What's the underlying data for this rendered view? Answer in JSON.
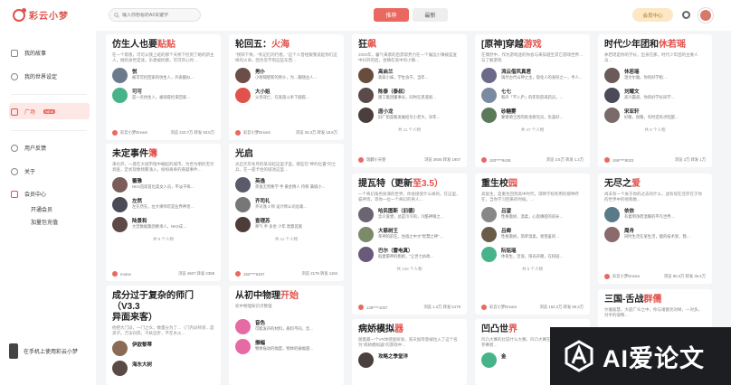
{
  "app": {
    "name": "彩云小梦"
  },
  "search": {
    "placeholder": "输入你想看的AI/关键字"
  },
  "tabs": [
    {
      "label": "推荐",
      "active": true
    },
    {
      "label": "最新",
      "active": false
    }
  ],
  "header": {
    "member_label": "会员中心"
  },
  "sidebar": {
    "items": [
      {
        "label": "我的故事",
        "icon": "book-icon"
      },
      {
        "label": "我的世界设定",
        "icon": "globe-icon"
      },
      {
        "label": "广场",
        "icon": "plaza-icon",
        "badge": "NEW",
        "active": true
      },
      {
        "label": "用户反馈",
        "icon": "feedback-icon"
      },
      {
        "label": "关于",
        "icon": "info-icon"
      },
      {
        "label": "会员中心",
        "icon": "crown-icon"
      }
    ],
    "sub_items": [
      "开通会员",
      "加量包充值"
    ],
    "app_banner": "在手机上使用彩云小梦"
  },
  "cards": [
    {
      "title": "仿生人也要",
      "title_accent": "贴贴",
      "desc": "在一个雨夜，可可从我上班的那个天桥下捡到了她的新主人，她的身世是谜，乐意被抚摸，可可开心时…",
      "chars": [
        {
          "name": "悦",
          "text": "被可可捡回家的仿生人，外表酷似…",
          "color": "#6b7b8c"
        },
        {
          "name": "可可",
          "text": "是一名仿生人，被雨夜捡来回家…",
          "color": "#47b38a"
        }
      ],
      "author": "彩云小梦Dream",
      "stats": "浏览 210.7万  转发 93.8万"
    },
    {
      "title": "未定事件",
      "title_accent": "簿",
      "desc": "来也开，一座在大城市暗中崛起的城市，为世为明的无尽调查，定式现象频繁涌入，纷纷离奇的悬疑事件…",
      "chars": [
        {
          "name": "蕾雅",
          "text": "NKX首席首位美女人员，平淡干练…",
          "color": "#7a5c5a"
        },
        {
          "name": "左然",
          "text": "左先然先，左大律师可是业界神话…",
          "color": "#4b4b58"
        },
        {
          "name": "陆景和",
          "text": "大型数据集团继承人，NKX成…",
          "color": "#5d4a46"
        }
      ],
      "more": "共 9 个人物",
      "author": "mome",
      "stats": "浏览 4607  转发 2358"
    },
    {
      "title": "成分过于复杂的师门（V3.3",
      "title_accent": "",
      "title_line2": "异面来客）",
      "desc": "他把大门派，一门之众，数量分为了…（门内派师弟…是弟子。万法归宗，千妖迈步，不在水火…",
      "chars": [
        {
          "name": "伊欧黎蒂",
          "text": "",
          "color": "#8b6b55"
        },
        {
          "name": "海东大树",
          "text": "",
          "color": "#5a4a45"
        }
      ],
      "author": "",
      "stats": ""
    },
    {
      "title": "轮回五：",
      "title_accent": "火海",
      "desc": "\"残阳下骨，\"有记忆的行者。\"这个人曾经跟我说起你们这样的火命，因为见不到这些东西…",
      "chars": [
        {
          "name": "男仆",
          "text": "小巷隔壁新的男仆，为…跟随主人…",
          "color": "#6b4e4a"
        },
        {
          "name": "大小姐",
          "text": "父母双亡，在家族斗争下面临…",
          "color": "#e1524c"
        }
      ],
      "author": "彩云小梦Dream",
      "stats": "浏览 26.3万  转发 18.8万"
    },
    {
      "title": "光启",
      "title_accent": "",
      "desc": "光启元年冬月的某日起这里子里，那些在\"神的位置\"的士兵，在一座卡住的城池这里…",
      "chars": [
        {
          "name": "英逸",
          "text": "英逸无畏要学 手 黄金情人 持称 满城小…",
          "color": "#5a5a6a"
        },
        {
          "name": "齐司礼",
          "text": "齐司逸 3 师 设计师公司总裁…",
          "color": "#777"
        },
        {
          "name": "查理苏",
          "text": "师气 手 多金 少年 周蓋首富",
          "color": "#4e3c38"
        }
      ],
      "more": "共 11 个人物",
      "author": "183****6207",
      "stats": "浏览 2179  转发 1194"
    },
    {
      "title": "从初中物理",
      "title_accent": "开始",
      "desc": "初中物理知识点整理",
      "chars": [
        {
          "name": "音色",
          "text": "可能发声的材料，质料不同，音…",
          "color": "#e66aa3"
        },
        {
          "name": "振幅",
          "text": "物体振动的幅度，物体的振幅越…",
          "color": "#e66aa3"
        }
      ],
      "author": "",
      "stats": ""
    },
    {
      "title": "狂",
      "title_accent": "飙",
      "desc": "2000年，暮气来袭的后黑帮势力在一个偏远小镇被蓝查中扫开的后，坐镇在高中的小镇…",
      "chars": [
        {
          "name": "高启兰",
          "text": "高家小妹，学生会干，当年…",
          "color": "#6a4c3e"
        },
        {
          "name": "陈泰（泰叔）",
          "text": "建工集团董事长，同时在黑道很…",
          "color": "#5a4a4a"
        },
        {
          "name": "唐小龙",
          "text": "旧厂街菜贩发展结号小老大，早年…",
          "color": "#4a3f3c"
        }
      ],
      "more": "共 11 个人物",
      "author": "瑞麟小天使",
      "stats": "浏览 3605  转发 1907"
    },
    {
      "title": "提瓦特（更新",
      "title_accent": "至3.5）",
      "desc": "一个奇幻角色扮演的世界，你会接受什么样的，在这里，猫神等，等你一位一个奇幻的男人…",
      "chars": [
        {
          "name": "哈民图斯（旧德）",
          "text": "念义爱想，总是冷冷的，冷酷神眼之…",
          "color": "#6c6472"
        },
        {
          "name": "大慈树王",
          "text": "草神的前任，住宿之中大\"智慧之神\"…",
          "color": "#7b8b6a"
        },
        {
          "name": "巴尔（雷电真）",
          "text": "稻妻雷神的胞姐，\"尘世七执政…",
          "color": "#6a5a7a"
        }
      ],
      "more": "共 126 个人物",
      "author": "138****1027",
      "stats": "浏览 1.2万  转发 5179"
    },
    {
      "title": "病娇模拟",
      "title_accent": "器",
      "desc": "随着最一个VR体感屋研发，某天加菲意被拉入了这个名为\"病娇模拟器\"的游戏中…",
      "chars": [
        {
          "name": "攻略之季堂洋",
          "text": "",
          "color": "#4a4040"
        }
      ],
      "author": "",
      "stats": ""
    },
    {
      "title": "[原神]穿越",
      "title_accent": "游戏",
      "desc": "在偶然中，作为游戏迷的你会与来穿越至其它游戏世界…与了解游戏",
      "chars": [
        {
          "name": "流云借风真君",
          "text": "璃月古代山神之主，现化人的身形之一，半人…",
          "color": "#6b6a8a"
        },
        {
          "name": "七七",
          "text": "和声「不卜庐」的年轻药采药员，…",
          "color": "#7a8aa0"
        },
        {
          "name": "砂糖雾",
          "text": "蒙德骑士团的炼金研究员，优美好…",
          "color": "#5a7a5a"
        }
      ],
      "more": "共 47 个人物",
      "author": "183****9428",
      "stats": "浏览 3.5万  转发 1.3万"
    },
    {
      "title": "重生校",
      "title_accent": "园",
      "desc": "高复生，是重生回到高中时代，得畸学校利用的那种存在，当你学习回来的时候，…",
      "chars": [
        {
          "name": "吕望",
          "text": "性格傲娇，温柔，心思缜密的班长…",
          "color": "#888"
        },
        {
          "name": "吕卿",
          "text": "性格傲娇，简单温柔，易害羞的…",
          "color": "#6b5c4a"
        },
        {
          "name": "阮铭瑶",
          "text": "体育生，活泼，阳光开朗，在校园…",
          "color": "#47b38a"
        }
      ],
      "more": "共 5 个人物",
      "author": "彩云小梦Dream",
      "stats": "浏览 152.2万  转发 85.3万"
    },
    {
      "title": "凹凸世",
      "title_accent": "界",
      "desc": "凹凸大赛的比较什么大赛，凹凸大赛在凹凸世界中大多数参赛者…",
      "chars": [
        {
          "name": "金",
          "text": "",
          "color": "#47b38a"
        }
      ],
      "author": "",
      "stats": ""
    },
    {
      "title": "时代少年团和",
      "title_accent": "休若瑶",
      "desc": "休若瑶是你的学长，出身在那，时代少年团的主要人员…",
      "chars": [
        {
          "name": "休若瑶",
          "text": "温文尔雅，你的好学姐…",
          "color": "#6a5a5a"
        },
        {
          "name": "刘耀文",
          "text": "高冷霸道，你的好学长同学…",
          "color": "#4a4a5a"
        },
        {
          "name": "宋亚轩",
          "text": "好暖，很暖，有时还有点吃醋…",
          "color": "#7a6a6a"
        }
      ],
      "more": "共 6 个人物",
      "author": "166****8023",
      "stats": "浏览 2万  转发 1万"
    },
    {
      "title": "无尽之",
      "title_accent": "爱",
      "desc": "尚未有一个关于你的过去的什么，滤有现在还存在于你的世界中的他和她…",
      "chars": [
        {
          "name": "依依",
          "text": "有着明净而温暖的平凡世界…",
          "color": "#5a7a8a"
        },
        {
          "name": "周舟",
          "text": "同时生活在某生活，能的枝术受，我…",
          "color": "#8a6a6a"
        }
      ],
      "author": "彩云小梦Dream",
      "stats": "浏览 80.3万  转发 45.4万"
    },
    {
      "title": "三国-舌战",
      "title_accent": "群儒",
      "desc": "尔雅聪慧，大庭广众之中，你与诸葛亮对峙，一对多，对手的谋略…",
      "chars": [],
      "author": "",
      "stats": ""
    }
  ],
  "watermark": {
    "text": "AI爱论文"
  }
}
